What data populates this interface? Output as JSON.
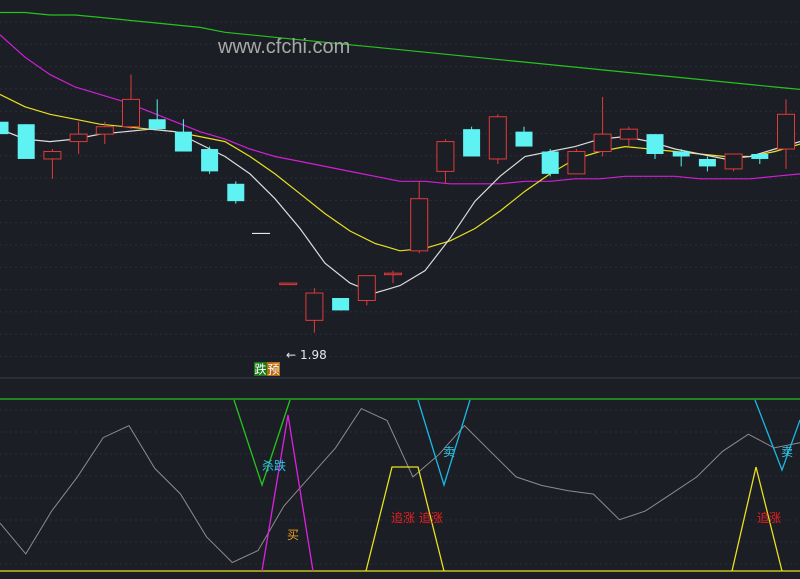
{
  "watermark": "www.cfchi.com",
  "colors": {
    "bg": "#1b1e25",
    "up": "#e03a3a",
    "down": "#5ef2f2",
    "ma_long": "#27c21f",
    "ma_mid": "#d21fd6",
    "ma_short": "#e8e020",
    "ma_fast": "#dcdcdc",
    "osc": "#8c8c8c",
    "cyan_ind": "#19b8e6",
    "green_ind": "#27c21f",
    "magenta_ind": "#e020e0",
    "yellow_ind": "#e8e020",
    "label_red": "#e82020",
    "label_orange": "#e8a020",
    "label_cyan": "#30c8e8"
  },
  "price_tag": "1.98",
  "badge": {
    "text1": "跌",
    "text2": "预"
  },
  "chart_data": [
    {
      "type": "candlestick",
      "ylim": [
        1.85,
        3.3
      ],
      "x": [
        0,
        1,
        2,
        3,
        4,
        5,
        6,
        7,
        8,
        9,
        10,
        11,
        12,
        13,
        14,
        15,
        16,
        17,
        18,
        19,
        20,
        21,
        22,
        23,
        24,
        25,
        26,
        27,
        28,
        29,
        30
      ],
      "candles": [
        {
          "o": 2.85,
          "h": 2.85,
          "l": 2.8,
          "c": 2.8
        },
        {
          "o": 2.84,
          "h": 2.84,
          "l": 2.7,
          "c": 2.7
        },
        {
          "o": 2.7,
          "h": 2.74,
          "l": 2.62,
          "c": 2.73
        },
        {
          "o": 2.77,
          "h": 2.85,
          "l": 2.72,
          "c": 2.8
        },
        {
          "o": 2.8,
          "h": 2.85,
          "l": 2.76,
          "c": 2.83
        },
        {
          "o": 2.83,
          "h": 3.04,
          "l": 2.82,
          "c": 2.94
        },
        {
          "o": 2.86,
          "h": 2.94,
          "l": 2.82,
          "c": 2.82
        },
        {
          "o": 2.81,
          "h": 2.86,
          "l": 2.73,
          "c": 2.73
        },
        {
          "o": 2.74,
          "h": 2.75,
          "l": 2.64,
          "c": 2.65
        },
        {
          "o": 2.6,
          "h": 2.61,
          "l": 2.52,
          "c": 2.53
        },
        {
          "o": null,
          "h": null,
          "l": null,
          "c": null
        },
        {
          "o": 2.2,
          "h": 2.2,
          "l": 2.2,
          "c": 2.2
        },
        {
          "o": 2.05,
          "h": 2.18,
          "l": 2.0,
          "c": 2.16
        },
        {
          "o": 2.14,
          "h": 2.14,
          "l": 2.09,
          "c": 2.09
        },
        {
          "o": 2.13,
          "h": 2.23,
          "l": 2.11,
          "c": 2.23
        },
        {
          "o": 2.24,
          "h": 2.25,
          "l": 2.2,
          "c": 2.24
        },
        {
          "o": 2.33,
          "h": 2.61,
          "l": 2.32,
          "c": 2.54
        },
        {
          "o": 2.65,
          "h": 2.78,
          "l": 2.6,
          "c": 2.77
        },
        {
          "o": 2.82,
          "h": 2.83,
          "l": 2.71,
          "c": 2.71
        },
        {
          "o": 2.7,
          "h": 2.88,
          "l": 2.68,
          "c": 2.87
        },
        {
          "o": 2.81,
          "h": 2.83,
          "l": 2.75,
          "c": 2.75
        },
        {
          "o": 2.73,
          "h": 2.74,
          "l": 2.63,
          "c": 2.64
        },
        {
          "o": 2.64,
          "h": 2.74,
          "l": 2.64,
          "c": 2.73
        },
        {
          "o": 2.73,
          "h": 2.95,
          "l": 2.71,
          "c": 2.8
        },
        {
          "o": 2.78,
          "h": 2.83,
          "l": 2.75,
          "c": 2.82
        },
        {
          "o": 2.8,
          "h": 2.8,
          "l": 2.7,
          "c": 2.72
        },
        {
          "o": 2.73,
          "h": 2.74,
          "l": 2.67,
          "c": 2.71
        },
        {
          "o": 2.7,
          "h": 2.71,
          "l": 2.65,
          "c": 2.67
        },
        {
          "o": 2.66,
          "h": 2.72,
          "l": 2.65,
          "c": 2.72
        },
        {
          "o": 2.72,
          "h": 2.72,
          "l": 2.68,
          "c": 2.7
        },
        {
          "o": 2.74,
          "h": 2.94,
          "l": 2.66,
          "c": 2.88
        },
        {
          "o": 2.89,
          "h": 3.03,
          "l": 2.76,
          "c": 2.87
        }
      ],
      "ma_fast": [
        2.82,
        2.78,
        2.77,
        2.78,
        2.8,
        2.81,
        2.82,
        2.81,
        2.76,
        2.71,
        2.64,
        2.54,
        2.42,
        2.28,
        2.2,
        2.16,
        2.19,
        2.25,
        2.38,
        2.53,
        2.63,
        2.71,
        2.73,
        2.75,
        2.78,
        2.79,
        2.77,
        2.74,
        2.72,
        2.7,
        2.71,
        2.74,
        2.77
      ],
      "ma_short": [
        2.96,
        2.91,
        2.88,
        2.86,
        2.84,
        2.83,
        2.82,
        2.81,
        2.79,
        2.77,
        2.71,
        2.64,
        2.56,
        2.48,
        2.41,
        2.36,
        2.33,
        2.34,
        2.37,
        2.42,
        2.49,
        2.57,
        2.64,
        2.7,
        2.73,
        2.75,
        2.74,
        2.73,
        2.72,
        2.71,
        2.71,
        2.73,
        2.76
      ],
      "ma_mid": [
        3.2,
        3.11,
        3.04,
        2.99,
        2.96,
        2.93,
        2.89,
        2.85,
        2.81,
        2.78,
        2.74,
        2.71,
        2.69,
        2.67,
        2.65,
        2.63,
        2.61,
        2.61,
        2.6,
        2.6,
        2.6,
        2.61,
        2.61,
        2.62,
        2.62,
        2.63,
        2.63,
        2.63,
        2.62,
        2.62,
        2.62,
        2.63,
        2.64
      ],
      "ma_long": [
        3.29,
        3.29,
        3.28,
        3.28,
        3.27,
        3.26,
        3.25,
        3.24,
        3.23,
        3.21,
        3.2,
        3.19,
        3.18,
        3.17,
        3.16,
        3.15,
        3.14,
        3.13,
        3.12,
        3.11,
        3.1,
        3.09,
        3.08,
        3.07,
        3.06,
        3.05,
        3.04,
        3.03,
        3.02,
        3.01,
        3.0,
        2.99,
        2.98
      ]
    },
    {
      "type": "line",
      "ylim": [
        0,
        100
      ],
      "osc": [
        28,
        10,
        35,
        55,
        78,
        85,
        60,
        45,
        20,
        5,
        12,
        38,
        55,
        72,
        95,
        88,
        55,
        68,
        85,
        70,
        55,
        50,
        47,
        45,
        30,
        35,
        45,
        55,
        70,
        80,
        72,
        75
      ],
      "labels": {
        "sha_die": "杀跌",
        "mai": "买",
        "zhuizhang1": "追涨 追涨",
        "mai_sell": "卖",
        "mai_sell2": "卖",
        "zhuizhang2": "追涨"
      }
    }
  ]
}
